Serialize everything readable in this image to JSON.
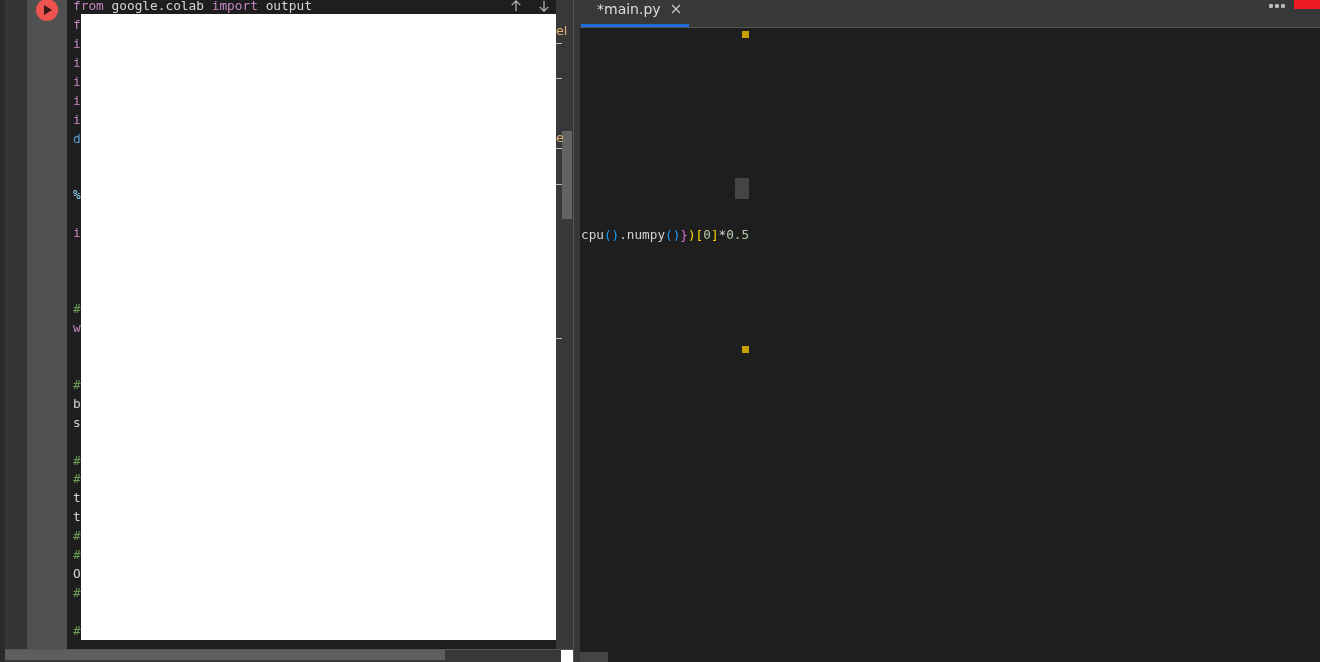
{
  "notebook": {
    "code_lines": [
      {
        "tokens": [
          {
            "text": "from",
            "kind": "keyword"
          },
          {
            "text": " google.colab ",
            "kind": "plain"
          },
          {
            "text": "import",
            "kind": "keyword"
          },
          {
            "text": " output",
            "kind": "plain"
          }
        ]
      },
      {
        "tokens": [
          {
            "text": "f",
            "kind": "keyword"
          }
        ]
      },
      {
        "tokens": [
          {
            "text": "i",
            "kind": "keyword"
          }
        ]
      },
      {
        "tokens": [
          {
            "text": "i",
            "kind": "keyword"
          }
        ]
      },
      {
        "tokens": [
          {
            "text": "i",
            "kind": "keyword"
          }
        ]
      },
      {
        "tokens": [
          {
            "text": "i",
            "kind": "keyword"
          }
        ]
      },
      {
        "tokens": [
          {
            "text": "i",
            "kind": "keyword"
          }
        ]
      },
      {
        "tokens": [
          {
            "text": "d",
            "kind": "def"
          }
        ]
      },
      {
        "kind": "blank"
      },
      {
        "kind": "blank"
      },
      {
        "tokens": [
          {
            "text": "%",
            "kind": "magic"
          }
        ]
      },
      {
        "kind": "blank"
      },
      {
        "tokens": [
          {
            "text": "i",
            "kind": "keyword"
          }
        ]
      },
      {
        "kind": "blank"
      },
      {
        "kind": "blank"
      },
      {
        "kind": "blank"
      },
      {
        "tokens": [
          {
            "text": "#",
            "kind": "comment"
          }
        ]
      },
      {
        "tokens": [
          {
            "text": "w",
            "kind": "keyword"
          }
        ]
      },
      {
        "kind": "blank"
      },
      {
        "kind": "blank"
      },
      {
        "tokens": [
          {
            "text": "#",
            "kind": "comment"
          }
        ]
      },
      {
        "tokens": [
          {
            "text": "b",
            "kind": "plain"
          }
        ]
      },
      {
        "tokens": [
          {
            "text": "s",
            "kind": "plain"
          }
        ]
      },
      {
        "kind": "blank"
      },
      {
        "tokens": [
          {
            "text": "#",
            "kind": "comment"
          }
        ]
      },
      {
        "tokens": [
          {
            "text": "#",
            "kind": "comment"
          }
        ]
      },
      {
        "tokens": [
          {
            "text": "t",
            "kind": "plain"
          }
        ]
      },
      {
        "tokens": [
          {
            "text": "t",
            "kind": "plain"
          }
        ]
      },
      {
        "tokens": [
          {
            "text": "#",
            "kind": "comment"
          }
        ]
      },
      {
        "tokens": [
          {
            "text": "#",
            "kind": "comment"
          }
        ]
      },
      {
        "tokens": [
          {
            "text": "O",
            "kind": "plain"
          }
        ]
      },
      {
        "tokens": [
          {
            "text": "#",
            "kind": "comment"
          }
        ]
      },
      {
        "kind": "blank"
      },
      {
        "tokens": [
          {
            "text": "#",
            "kind": "comment"
          }
        ]
      }
    ],
    "edge_fragments": [
      "el",
      "e"
    ]
  },
  "editor": {
    "tabs": [
      {
        "label": "*main.py",
        "selected": true
      }
    ],
    "code_line": [
      {
        "text": "cpu",
        "kind": "plain"
      },
      {
        "text": "()",
        "kind": "paren"
      },
      {
        "text": ".numpy",
        "kind": "plain"
      },
      {
        "text": "()",
        "kind": "paren"
      },
      {
        "text": "}",
        "kind": "brace"
      },
      {
        "text": ")[",
        "kind": "bracket"
      },
      {
        "text": "0",
        "kind": "number"
      },
      {
        "text": "]",
        "kind": "bracket"
      },
      {
        "text": "*",
        "kind": "plain"
      },
      {
        "text": "0.5",
        "kind": "number"
      }
    ]
  }
}
